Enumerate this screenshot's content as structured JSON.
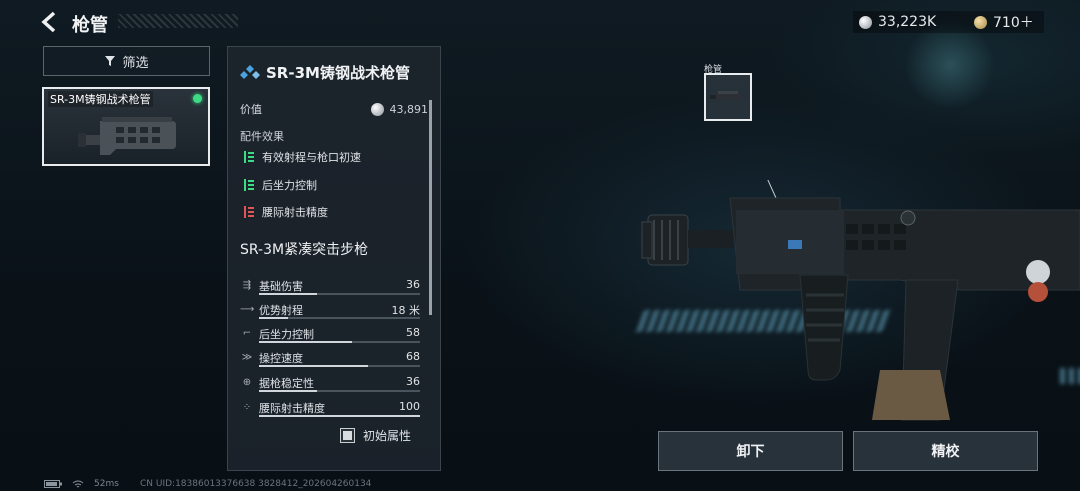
{
  "header": {
    "back_icon": "chevron-left-icon",
    "title": "枪管"
  },
  "currency": {
    "silver": "33,223K",
    "gold": "710＋"
  },
  "filter": {
    "label": "筛选",
    "icon": "filter-icon"
  },
  "item": {
    "name": "SR-3M铸钢战术枪管",
    "equipped_color": "#3ddc84"
  },
  "panel": {
    "title": "SR-3M铸钢战术枪管",
    "value_label": "价值",
    "value": "43,891",
    "effects_label": "配件效果",
    "effects": [
      {
        "label": "有效射程与枪口初速",
        "direction": "up"
      },
      {
        "label": "后坐力控制",
        "direction": "up"
      },
      {
        "label": "腰际射击精度",
        "direction": "down"
      }
    ],
    "weapon_name": "SR-3M紧凑突击步枪",
    "stats": [
      {
        "label": "基础伤害",
        "value": "36",
        "level": 0.36,
        "icon": "damage-icon"
      },
      {
        "label": "优势射程",
        "value": "18 米",
        "level": 0.18,
        "icon": "range-icon"
      },
      {
        "label": "后坐力控制",
        "value": "58",
        "level": 0.58,
        "icon": "recoil-icon"
      },
      {
        "label": "操控速度",
        "value": "68",
        "level": 0.68,
        "icon": "handling-icon"
      },
      {
        "label": "据枪稳定性",
        "value": "36",
        "level": 0.36,
        "icon": "stability-icon"
      },
      {
        "label": "腰际射击精度",
        "value": "100",
        "level": 1.0,
        "icon": "hipfire-icon"
      }
    ],
    "initial_attr_label": "初始属性"
  },
  "slot": {
    "label": "枪管"
  },
  "actions": {
    "unequip": "卸下",
    "tune": "精校"
  },
  "footer": {
    "ping": "52ms",
    "uid": "CN UID:18386013376638 3828412_202604260134"
  },
  "colors": {
    "up": "#3ddc84",
    "down": "#e05555",
    "accent": "#4aa3df"
  }
}
